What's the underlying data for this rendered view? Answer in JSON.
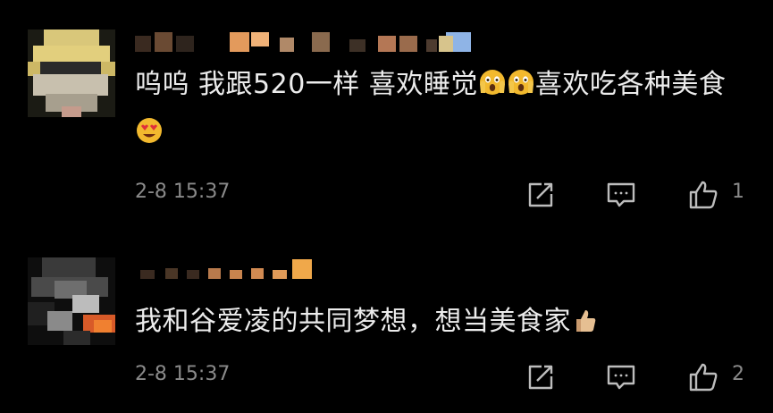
{
  "comments": [
    {
      "text": "呜呜 我跟520一样 喜欢睡觉",
      "text_tail": "喜欢吃各种美食",
      "emojis": [
        "screaming-face-emoji",
        "screaming-face-emoji",
        "heart-eyes-emoji"
      ],
      "time": "2-8 15:37",
      "likes": "1"
    },
    {
      "text": "我和谷爱凌的共同梦想，想当美食家",
      "emojis": [
        "thumbs-up-emoji"
      ],
      "time": "2-8 15:37",
      "likes": "2"
    }
  ],
  "icons": [
    "share-icon",
    "reply-icon",
    "like-icon"
  ],
  "colors": {
    "background": "#000000",
    "text": "#ececec",
    "meta": "#8a8a8a"
  }
}
